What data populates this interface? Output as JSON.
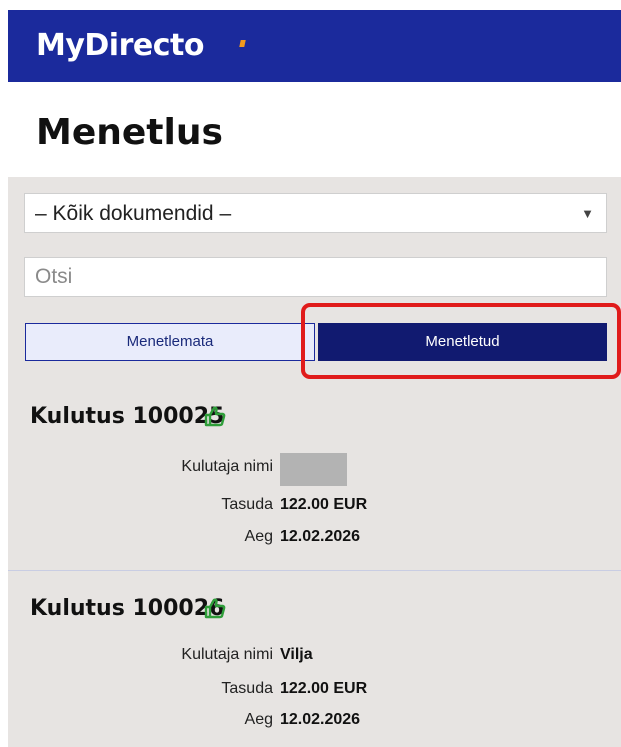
{
  "header": {
    "logo_text": "MyDirecto",
    "brand_color": "#1b2a9c",
    "logo_accent_color": "#f29a1d"
  },
  "page": {
    "title": "Menetlus"
  },
  "filters": {
    "document_select_value": "– Kõik dokumendid –",
    "search_placeholder": "Otsi",
    "search_value": ""
  },
  "tabs": [
    {
      "label": "Menetlemata",
      "active": false
    },
    {
      "label": "Menetletud",
      "active": true
    }
  ],
  "highlight_color": "#e01b1b",
  "records": [
    {
      "title": "Kulutus 100025",
      "status_icon": "thumbs-up-icon",
      "fields": [
        {
          "label": "Kulutaja nimi",
          "value": "",
          "redacted": true
        },
        {
          "label": "Tasuda",
          "value": "122.00 EUR"
        },
        {
          "label": "Aeg",
          "value": "12.02.2026"
        }
      ]
    },
    {
      "title": "Kulutus 100026",
      "status_icon": "thumbs-up-icon",
      "fields": [
        {
          "label": "Kulutaja nimi",
          "value": "Vilja"
        },
        {
          "label": "Tasuda",
          "value": "122.00 EUR"
        },
        {
          "label": "Aeg",
          "value": "12.02.2026"
        }
      ]
    }
  ]
}
